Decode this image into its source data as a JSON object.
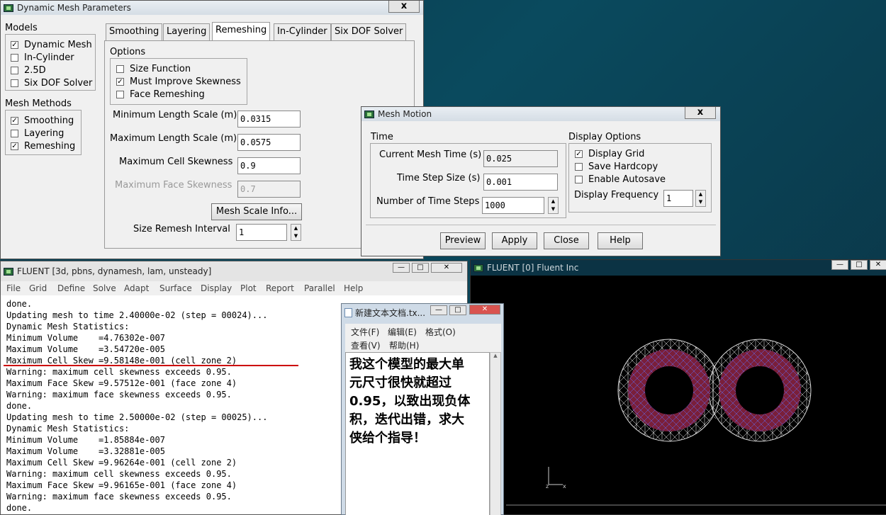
{
  "dmp": {
    "title": "Dynamic Mesh Parameters",
    "close": "x",
    "models_label": "Models",
    "models": [
      {
        "label": "Dynamic Mesh",
        "checked": true
      },
      {
        "label": "In-Cylinder",
        "checked": false
      },
      {
        "label": "2.5D",
        "checked": false
      },
      {
        "label": "Six DOF Solver",
        "checked": false
      }
    ],
    "methods_label": "Mesh Methods",
    "methods": [
      {
        "label": "Smoothing",
        "checked": true
      },
      {
        "label": "Layering",
        "checked": false
      },
      {
        "label": "Remeshing",
        "checked": true
      }
    ],
    "tabs": [
      "Smoothing",
      "Layering",
      "Remeshing",
      "In-Cylinder",
      "Six DOF Solver"
    ],
    "options_label": "Options",
    "options": [
      {
        "label": "Size Function",
        "checked": false
      },
      {
        "label": "Must Improve Skewness",
        "checked": true
      },
      {
        "label": "Face Remeshing",
        "checked": false
      }
    ],
    "min_len_label": "Minimum Length Scale (m)",
    "min_len": "0.0315",
    "max_len_label": "Maximum Length Scale (m)",
    "max_len": "0.0575",
    "max_cell_skew_label": "Maximum Cell Skewness",
    "max_cell_skew": "0.9",
    "max_face_skew_label": "Maximum Face Skewness",
    "max_face_skew": "0.7",
    "mesh_scale_btn": "Mesh Scale Info...",
    "remesh_interval_label": "Size Remesh Interval",
    "remesh_interval": "1"
  },
  "mm": {
    "title": "Mesh Motion",
    "close": "x",
    "time_label": "Time",
    "current_time_label": "Current Mesh Time (s)",
    "current_time": "0.025",
    "step_size_label": "Time Step Size (s)",
    "step_size": "0.001",
    "num_steps_label": "Number of Time Steps",
    "num_steps": "1000",
    "display_label": "Display Options",
    "display_options": [
      {
        "label": "Display Grid",
        "checked": true
      },
      {
        "label": "Save Hardcopy",
        "checked": false
      },
      {
        "label": "Enable Autosave",
        "checked": false
      }
    ],
    "freq_label": "Display Frequency",
    "freq": "1",
    "buttons": [
      "Preview",
      "Apply",
      "Close",
      "Help"
    ]
  },
  "fluent": {
    "title": "FLUENT  [3d, pbns, dynamesh, lam, unsteady]",
    "menu": [
      "File",
      "Grid",
      "Define",
      "Solve",
      "Adapt",
      "Surface",
      "Display",
      "Plot",
      "Report",
      "Parallel",
      "Help"
    ],
    "lines": [
      "done.",
      "Updating mesh to time 2.40000e-02 (step = 00024)...",
      "Dynamic Mesh Statistics:",
      "Minimum Volume    =4.76302e-007",
      "Maximum Volume    =3.54720e-005",
      "Maximum Cell Skew =9.58148e-001 (cell zone 2)",
      "Warning: maximum cell skewness exceeds 0.95.",
      "Maximum Face Skew =9.57512e-001 (face zone 4)",
      "Warning: maximum face skewness exceeds 0.95.",
      "done.",
      "Updating mesh to time 2.50000e-02 (step = 00025)...",
      "Dynamic Mesh Statistics:",
      "Minimum Volume    =1.85884e-007",
      "Maximum Volume    =3.32881e-005",
      "Maximum Cell Skew =9.96264e-001 (cell zone 2)",
      "Warning: maximum cell skewness exceeds 0.95.",
      "Maximum Face Skew =9.96165e-001 (face zone 4)",
      "Warning: maximum face skewness exceeds 0.95.",
      "done."
    ]
  },
  "graphics": {
    "title": "FLUENT [0] Fluent Inc",
    "axis_z": "z",
    "axis_x": "x"
  },
  "notepad": {
    "title": "新建文本文档.tx...",
    "menu": [
      "文件(F)",
      "编辑(E)",
      "格式(O)",
      "查看(V)",
      "帮助(H)"
    ],
    "text_lines": [
      "我这个模型的最大单",
      "元尺寸很快就超过",
      "0.95，以致出现负体",
      "积，迭代出错，求大",
      "侠给个指导！"
    ]
  },
  "colors": {
    "annotation": "#cc0000",
    "mesh": "#ffffff",
    "mesh_fill": "#7a1f3a"
  }
}
